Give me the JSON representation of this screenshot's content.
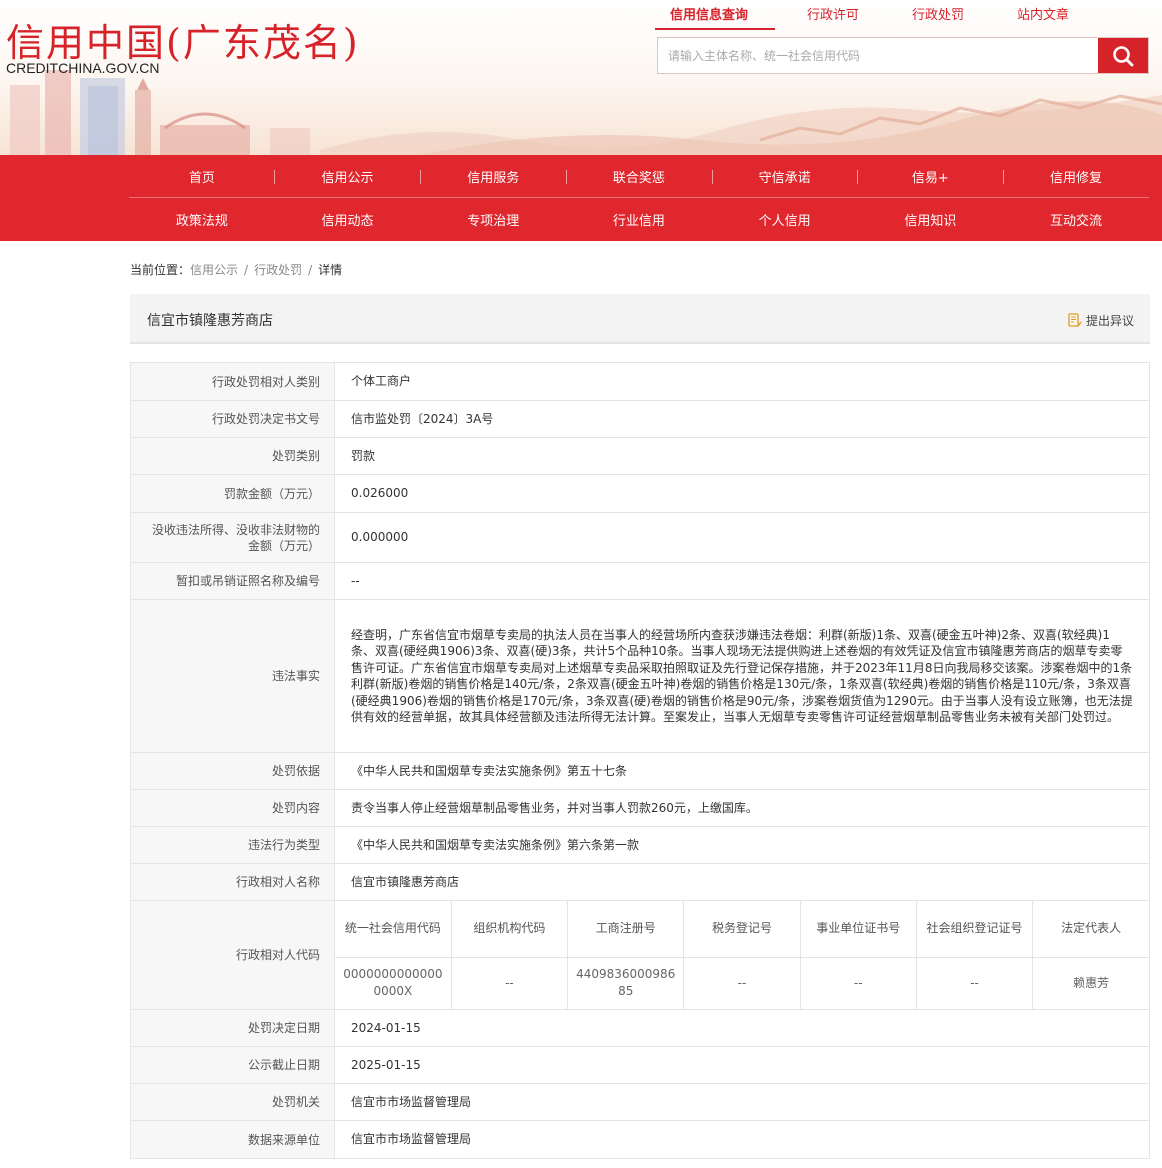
{
  "brand": {
    "title": "信用中国(广东茂名)",
    "url": "CREDITCHINA.GOV.CN"
  },
  "top_nav": [
    {
      "label": "信用信息查询",
      "active": true
    },
    {
      "label": "行政许可",
      "active": false
    },
    {
      "label": "行政处罚",
      "active": false
    },
    {
      "label": "站内文章",
      "active": false
    }
  ],
  "search": {
    "placeholder": "请输入主体名称、统一社会信用代码",
    "icon": "search-icon"
  },
  "main_nav": {
    "row1": [
      "首页",
      "信用公示",
      "信用服务",
      "联合奖惩",
      "守信承诺",
      "信易+",
      "信用修复"
    ],
    "row2": [
      "政策法规",
      "信用动态",
      "专项治理",
      "行业信用",
      "个人信用",
      "信用知识",
      "互动交流"
    ]
  },
  "breadcrumb": {
    "prefix": "当前位置：",
    "items": [
      "信用公示",
      "行政处罚",
      "详情"
    ]
  },
  "entity": {
    "name": "信宜市镇隆惠芳商店",
    "objection_label": "提出异议",
    "objection_icon": "document-edit-icon"
  },
  "details": [
    {
      "label": "行政处罚相对人类别",
      "value": "个体工商户"
    },
    {
      "label": "行政处罚决定书文号",
      "value": "信市监处罚〔2024〕3A号"
    },
    {
      "label": "处罚类别",
      "value": "罚款"
    },
    {
      "label": "罚款金额（万元）",
      "value": "0.026000"
    },
    {
      "label": "没收违法所得、没收非法财物的金额（万元）",
      "value": "0.000000"
    },
    {
      "label": "暂扣或吊销证照名称及编号",
      "value": "--"
    },
    {
      "label": "违法事实",
      "value": "经查明，广东省信宜市烟草专卖局的执法人员在当事人的经营场所内查获涉嫌违法卷烟：利群(新版)1条、双喜(硬金五叶神)2条、双喜(软经典)1条、双喜(硬经典1906)3条、双喜(硬)3条，共计5个品种10条。当事人现场无法提供购进上述卷烟的有效凭证及信宜市镇隆惠芳商店的烟草专卖零售许可证。广东省信宜市烟草专卖局对上述烟草专卖品采取拍照取证及先行登记保存措施，并于2023年11月8日向我局移交该案。涉案卷烟中的1条利群(新版)卷烟的销售价格是140元/条，2条双喜(硬金五叶神)卷烟的销售价格是130元/条，1条双喜(软经典)卷烟的销售价格是110元/条，3条双喜(硬经典1906)卷烟的销售价格是170元/条，3条双喜(硬)卷烟的销售价格是90元/条，涉案卷烟货值为1290元。由于当事人没有设立账簿，也无法提供有效的经营单据，故其具体经营额及违法所得无法计算。至案发止，当事人无烟草专卖零售许可证经营烟草制品零售业务未被有关部门处罚过。"
    },
    {
      "label": "处罚依据",
      "value": "《中华人民共和国烟草专卖法实施条例》第五十七条"
    },
    {
      "label": "处罚内容",
      "value": "责令当事人停止经营烟草制品零售业务，并对当事人罚款260元，上缴国库。"
    },
    {
      "label": "违法行为类型",
      "value": "《中华人民共和国烟草专卖法实施条例》第六条第一款"
    },
    {
      "label": "行政相对人名称",
      "value": "信宜市镇隆惠芳商店"
    }
  ],
  "codes": {
    "label": "行政相对人代码",
    "headers": [
      "统一社会信用代码",
      "组织机构代码",
      "工商注册号",
      "税务登记号",
      "事业单位证书号",
      "社会组织登记证号",
      "法定代表人"
    ],
    "values": [
      "00000000000000000X",
      "--",
      "440983600098685",
      "--",
      "--",
      "--",
      "赖惠芳"
    ]
  },
  "details_after": [
    {
      "label": "处罚决定日期",
      "value": "2024-01-15"
    },
    {
      "label": "公示截止日期",
      "value": "2025-01-15"
    },
    {
      "label": "处罚机关",
      "value": "信宜市市场监督管理局"
    },
    {
      "label": "数据来源单位",
      "value": "信宜市市场监督管理局"
    }
  ],
  "colors": {
    "brand_red": "#e0272e",
    "logo_red": "#d6232a"
  }
}
